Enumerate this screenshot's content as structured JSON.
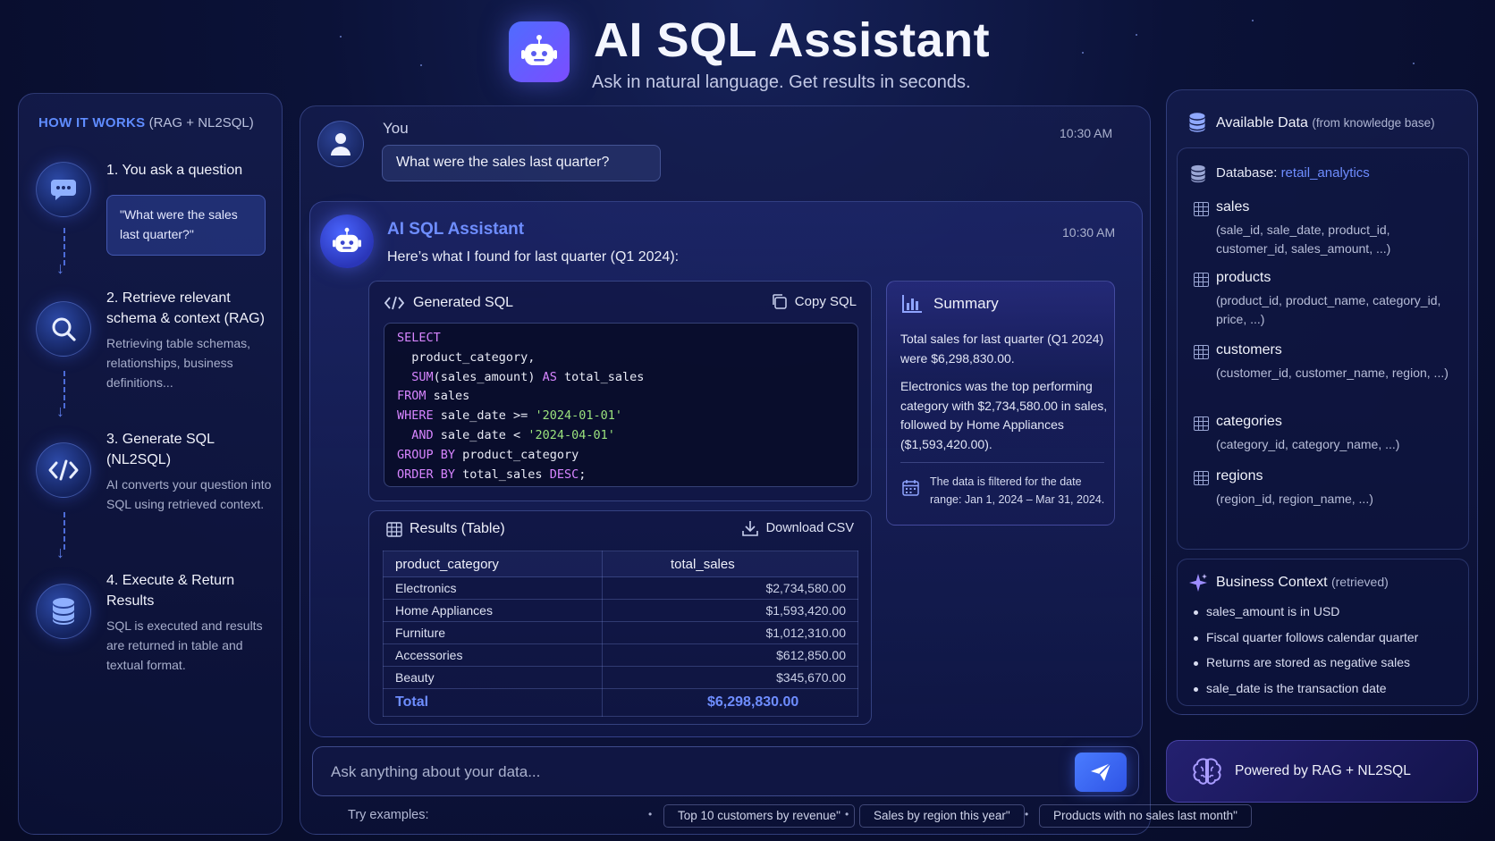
{
  "header": {
    "title": "AI SQL Assistant",
    "subtitle": "Ask in natural language. Get results in seconds."
  },
  "how_it_works": {
    "title": "HOW IT WORKS",
    "title_suffix": "(RAG + NL2SQL)",
    "steps": [
      {
        "title": "1. You ask a question",
        "quote": "\"What were the sales last quarter?\"",
        "icon": "chat-bubble-icon"
      },
      {
        "title": "2. Retrieve relevant schema & context (RAG)",
        "desc": "Retrieving table schemas, relationships, business definitions...",
        "icon": "search-icon"
      },
      {
        "title": "3. Generate SQL (NL2SQL)",
        "desc": "AI converts your question into SQL using retrieved context.",
        "icon": "code-icon"
      },
      {
        "title": "4. Execute & Return Results",
        "desc": "SQL is executed and results are returned in table and textual format.",
        "icon": "database-icon"
      }
    ]
  },
  "chat": {
    "user": {
      "label": "You",
      "time": "10:30 AM",
      "message": "What were the sales last quarter?"
    },
    "assistant": {
      "name": "AI SQL Assistant",
      "time": "10:30 AM",
      "intro": "Here’s what I found for last quarter (Q1 2024):",
      "sql": {
        "label": "Generated SQL",
        "copy_label": "Copy SQL"
      },
      "summary": {
        "label": "Summary",
        "p1": "Total sales for last quarter (Q1 2024) were $6,298,830.00.",
        "p2": "Electronics was the top performing category with $2,734,580.00 in sales, followed by Home Appliances ($1,593,420.00).",
        "note": "The data is filtered for the date range: Jan 1, 2024 – Mar 31, 2024."
      },
      "results": {
        "label": "Results (Table)",
        "download_label": "Download CSV",
        "columns": [
          "product_category",
          "total_sales"
        ],
        "rows": [
          [
            "Electronics",
            "$2,734,580.00"
          ],
          [
            "Home Appliances",
            "$1,593,420.00"
          ],
          [
            "Furniture",
            "$1,012,310.00"
          ],
          [
            "Accessories",
            "$612,850.00"
          ],
          [
            "Beauty",
            "$345,670.00"
          ]
        ],
        "total_label": "Total",
        "total_value": "$6,298,830.00"
      }
    },
    "input": {
      "placeholder": "Ask anything about your data...",
      "examples_label": "Try examples:",
      "examples": [
        "Top 10 customers by revenue\"",
        "Sales by region this year\"",
        "Products with no sales last month\""
      ],
      "separator": "•"
    }
  },
  "available_data": {
    "title": "Available Data",
    "title_suffix": "(from knowledge base)",
    "database_label": "Database:",
    "database_name": "retail_analytics",
    "tables": [
      {
        "name": "sales",
        "columns": "(sale_id, sale_date, product_id, customer_id, sales_amount, ...)"
      },
      {
        "name": "products",
        "columns": "(product_id, product_name, category_id, price, ...)"
      },
      {
        "name": "customers",
        "columns": "(customer_id, customer_name, region, ...)"
      },
      {
        "name": "categories",
        "columns": "(category_id, category_name, ...)"
      },
      {
        "name": "regions",
        "columns": "(region_id, region_name, ...)"
      }
    ]
  },
  "business_context": {
    "title": "Business Context",
    "title_suffix": "(retrieved)",
    "items": [
      {
        "code": "sales_amount",
        "text": " is in USD"
      },
      {
        "code": "",
        "text": "Fiscal quarter follows calendar quarter"
      },
      {
        "code": "",
        "text": "Returns are stored as negative sales"
      },
      {
        "code": "sale_date",
        "text": " is the transaction date"
      }
    ]
  },
  "powered_by": "Powered by RAG + NL2SQL",
  "colors": {
    "accent": "#6e8dff",
    "sql_keyword": "#d785ff",
    "sql_string": "#9be37d",
    "background": "#0b1238"
  }
}
